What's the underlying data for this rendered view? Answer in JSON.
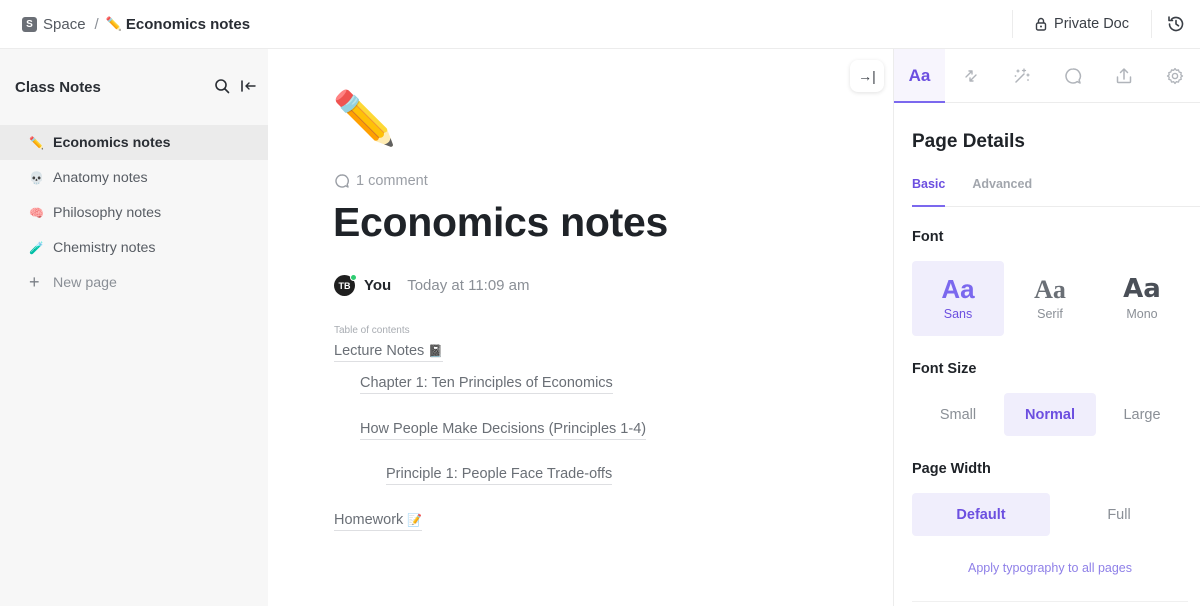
{
  "breadcrumb": {
    "space_initial": "S",
    "space_label": "Space",
    "separator": "/",
    "page_emoji": "✏️",
    "page_label": "Economics notes"
  },
  "topbar": {
    "private_doc_label": "Private Doc",
    "lock_icon": "lock-icon",
    "history_icon": "history-icon"
  },
  "sidebar": {
    "title": "Class Notes",
    "search_icon": "search-icon",
    "collapse_icon": "collapse-left-icon",
    "items": [
      {
        "emoji": "✏️",
        "label": "Economics notes",
        "active": true
      },
      {
        "emoji": "💀",
        "label": "Anatomy notes",
        "active": false
      },
      {
        "emoji": "🧠",
        "label": "Philosophy notes",
        "active": false
      },
      {
        "emoji": "🧪",
        "label": "Chemistry notes",
        "active": false
      }
    ],
    "new_page": {
      "icon": "+",
      "label": "New page"
    }
  },
  "document": {
    "emoji": "✏️",
    "comments": "1 comment",
    "title": "Economics notes",
    "author_initials": "TB",
    "author_name": "You",
    "timestamp": "Today at 11:09 am",
    "toc_label": "Table of contents",
    "toc": [
      {
        "label": "Lecture Notes",
        "emoji": "📓",
        "level": 1
      },
      {
        "label": "Chapter 1: Ten Principles of Economics",
        "emoji": "",
        "level": 2
      },
      {
        "label": "How People Make Decisions (Principles 1-4)",
        "emoji": "",
        "level": 2
      },
      {
        "label": "Principle 1: People Face Trade-offs",
        "emoji": "",
        "level": 3
      },
      {
        "label": "Homework",
        "emoji": "📝",
        "level": 1
      }
    ]
  },
  "right_panel": {
    "collapse_icon": "→|",
    "tabs": [
      {
        "name": "typography",
        "label": "Aa",
        "active": true
      },
      {
        "name": "relationships",
        "icon": "arrows-icon"
      },
      {
        "name": "ai",
        "icon": "magic-wand-icon"
      },
      {
        "name": "comments",
        "icon": "comment-icon"
      },
      {
        "name": "share",
        "icon": "upload-icon"
      },
      {
        "name": "settings",
        "icon": "gear-icon"
      }
    ],
    "title": "Page Details",
    "subtabs": [
      {
        "label": "Basic",
        "active": true
      },
      {
        "label": "Advanced",
        "active": false
      }
    ],
    "font_label": "Font",
    "fonts": [
      {
        "sample": "Aa",
        "name": "Sans",
        "active": true
      },
      {
        "sample": "Aa",
        "name": "Serif",
        "active": false
      },
      {
        "sample": "Aa",
        "name": "Mono",
        "active": false
      }
    ],
    "font_size_label": "Font Size",
    "font_sizes": [
      {
        "label": "Small",
        "active": false
      },
      {
        "label": "Normal",
        "active": true
      },
      {
        "label": "Large",
        "active": false
      }
    ],
    "page_width_label": "Page Width",
    "page_widths": [
      {
        "label": "Default",
        "active": true
      },
      {
        "label": "Full",
        "active": false
      }
    ],
    "apply_link": "Apply typography to all pages"
  },
  "colors": {
    "accent": "#7b68ee",
    "accent_text": "#6c4fe0",
    "selected_bg": "#f0eefc",
    "sidebar_bg": "#f7f7f7",
    "online": "#2ecc71"
  }
}
